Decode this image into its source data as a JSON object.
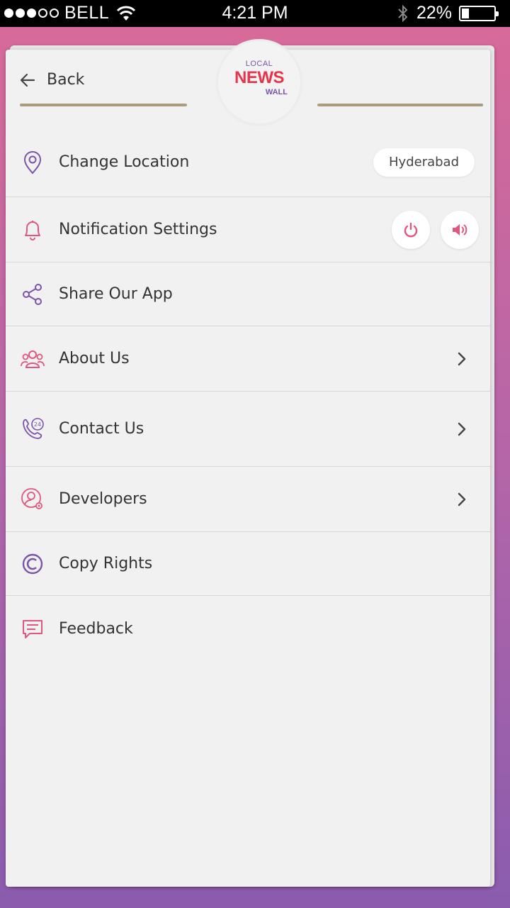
{
  "status_bar": {
    "carrier": "BELL",
    "time": "4:21 PM",
    "battery": "22%",
    "battery_level": 0.22
  },
  "header": {
    "back_label": "Back",
    "logo": {
      "top": "LOCAL",
      "middle": "NEWS",
      "bottom": "WALL"
    }
  },
  "menu": {
    "change_location": {
      "label": "Change Location",
      "value": "Hyderabad",
      "icon": "location-pin-icon"
    },
    "notification_settings": {
      "label": "Notification Settings",
      "icon": "bell-icon",
      "controls": [
        "power-icon",
        "speaker-icon"
      ]
    },
    "share": {
      "label": "Share Our App",
      "icon": "share-icon"
    },
    "about": {
      "label": "About Us",
      "icon": "group-icon"
    },
    "contact": {
      "label": "Contact Us",
      "icon": "phone-24-icon"
    },
    "developers": {
      "label": "Developers",
      "icon": "developer-gear-icon"
    },
    "copyrights": {
      "label": "Copy Rights",
      "icon": "copyright-icon"
    },
    "feedback": {
      "label": "Feedback",
      "icon": "chat-icon"
    }
  },
  "colors": {
    "accent_pink": "#e0567f",
    "accent_purple": "#7a54a8",
    "rule": "#ab9b7d",
    "logo_red": "#e8344a"
  }
}
